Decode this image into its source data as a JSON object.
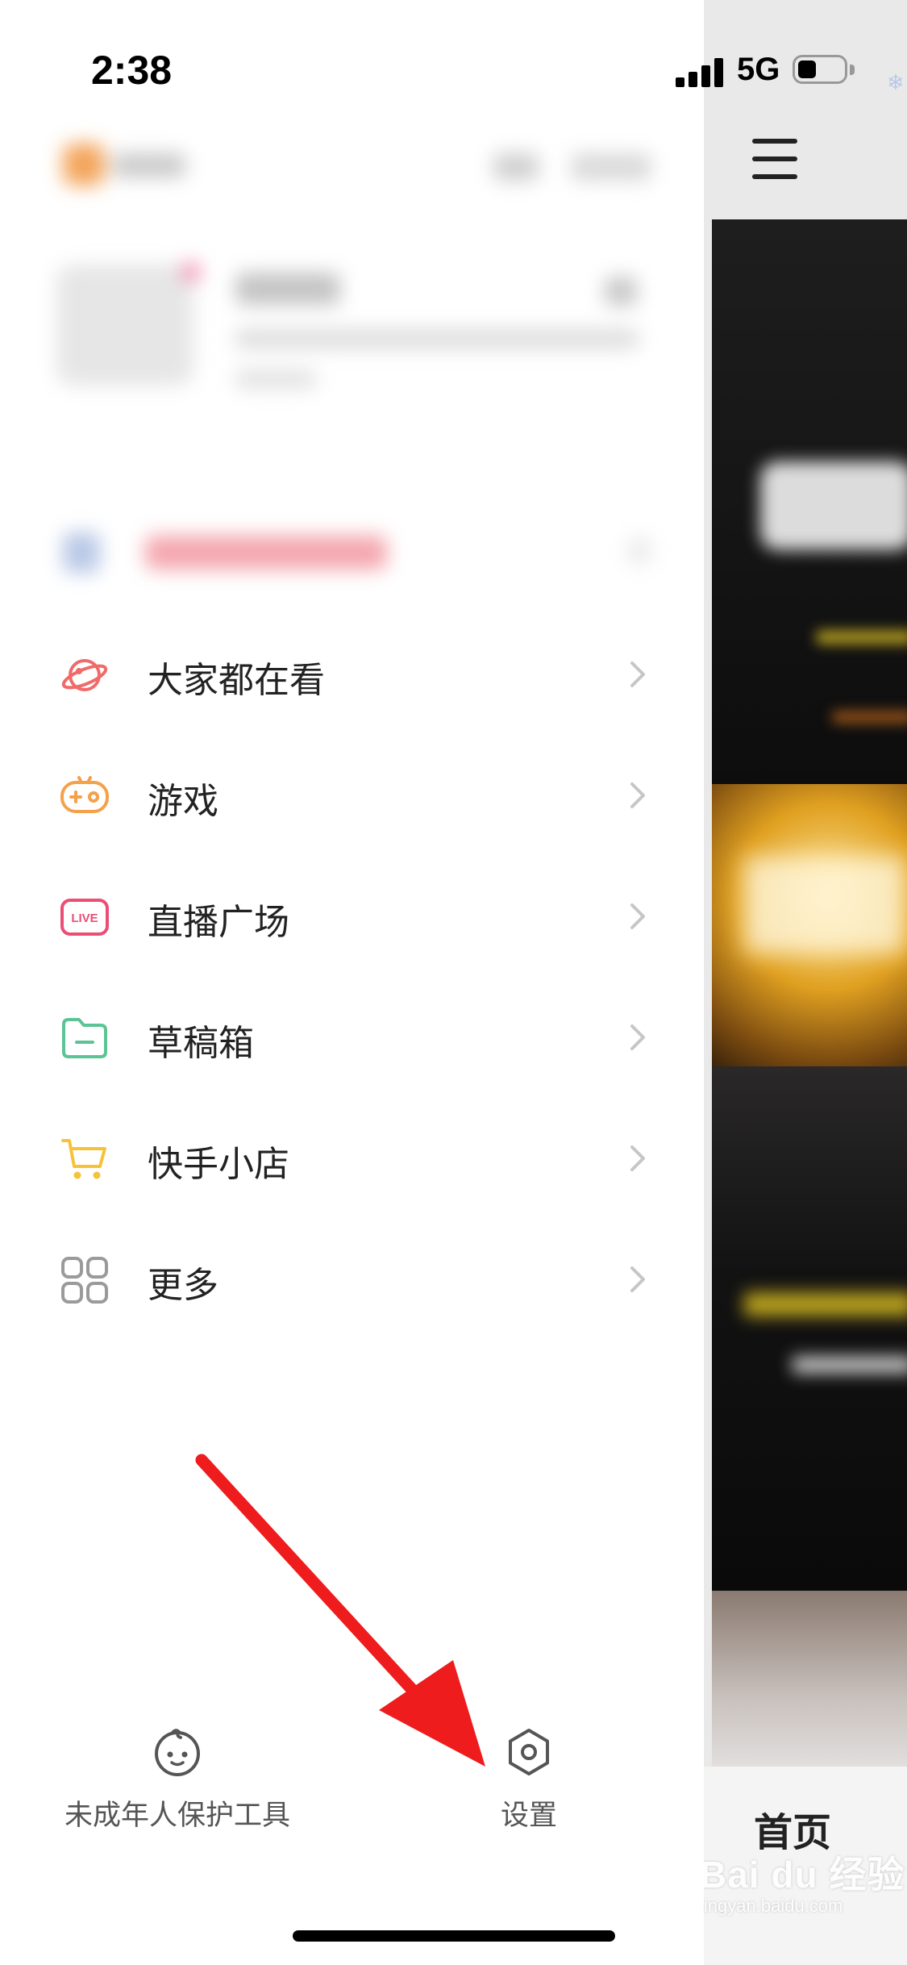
{
  "status_bar": {
    "time": "2:38",
    "network": "5G",
    "battery_level": 0.3
  },
  "menu": {
    "items": [
      {
        "label": "大家都在看",
        "icon": "planet-icon",
        "color": "#f06a6a"
      },
      {
        "label": "游戏",
        "icon": "gamepad-icon",
        "color": "#f4a14a"
      },
      {
        "label": "直播广场",
        "icon": "live-icon",
        "color": "#ec4d74",
        "icon_text": "LIVE"
      },
      {
        "label": "草稿箱",
        "icon": "folder-icon",
        "color": "#5bc495"
      },
      {
        "label": "快手小店",
        "icon": "cart-icon",
        "color": "#f5c33b"
      },
      {
        "label": "更多",
        "icon": "grid-icon",
        "color": "#9a9a9a"
      }
    ]
  },
  "bottom": {
    "minor_protection_label": "未成年人保护工具",
    "settings_label": "设置"
  },
  "main_page": {
    "home_tab_label": "首页"
  },
  "watermark": {
    "brand": "Bai du 经验",
    "url": "jingyan.baidu.com"
  },
  "colors": {
    "annotation_arrow": "#ee1c1c",
    "icon_gray": "#555555"
  }
}
